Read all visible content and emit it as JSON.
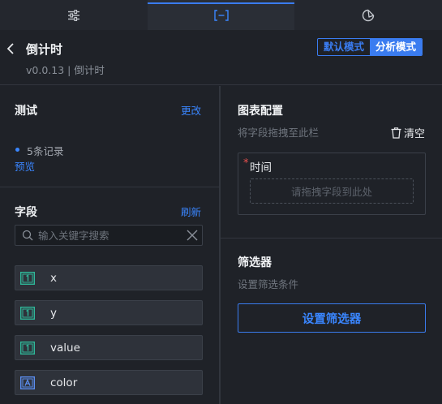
{
  "header": {
    "title": "倒计时",
    "subtitle": "v0.0.13 | 倒计时",
    "modes": [
      "默认模式",
      "分析模式"
    ]
  },
  "tabs": [
    {
      "icon": "sliders-icon"
    },
    {
      "icon": "bracket-field-icon",
      "active": true
    },
    {
      "icon": "refresh-shape-icon"
    }
  ],
  "test": {
    "title": "测试",
    "edit_label": "更改",
    "records": "5条记录",
    "preview_label": "预览"
  },
  "fields": {
    "title": "字段",
    "refresh_label": "刷新",
    "search_placeholder": "输入关键字搜索",
    "items": [
      {
        "name": "x",
        "type": "number"
      },
      {
        "name": "y",
        "type": "number"
      },
      {
        "name": "value",
        "type": "number"
      },
      {
        "name": "color",
        "type": "text"
      }
    ]
  },
  "chart_config": {
    "title": "图表配置",
    "hint": "将字段拖拽至此栏",
    "clear_label": "清空",
    "time_label": "时间",
    "required_mark": "*",
    "drop_placeholder": "请拖拽字段到此处"
  },
  "filter": {
    "title": "筛选器",
    "hint": "设置筛选条件",
    "button_label": "设置筛选器"
  },
  "colors": {
    "accent": "#3a7cf0",
    "background": "#1f2228",
    "required": "#e8504e",
    "field_icon_number": "#2fb89a",
    "field_icon_text": "#5b8def"
  }
}
